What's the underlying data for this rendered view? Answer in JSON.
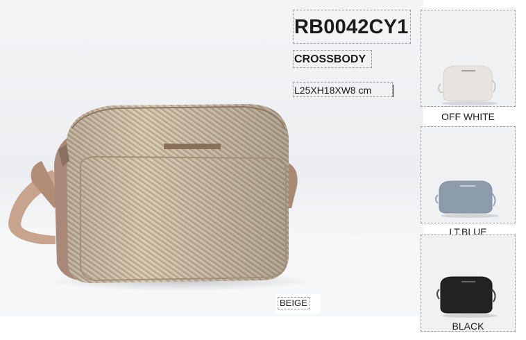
{
  "product": {
    "sku": "RB0042CY1",
    "category": "CROSSBODY",
    "dimensions": "L25XH18XW8 cm",
    "main_color": "BEIGE"
  },
  "variants": [
    {
      "label": "OFF WHITE",
      "color": "#e7e4df"
    },
    {
      "label": "LT.BLUE",
      "color": "#8d9cad"
    },
    {
      "label": "BLACK",
      "color": "#222324"
    }
  ],
  "colors": {
    "beige_body": "#cdbca4",
    "beige_trim": "#a98a74",
    "text": "#1b1b1b"
  }
}
